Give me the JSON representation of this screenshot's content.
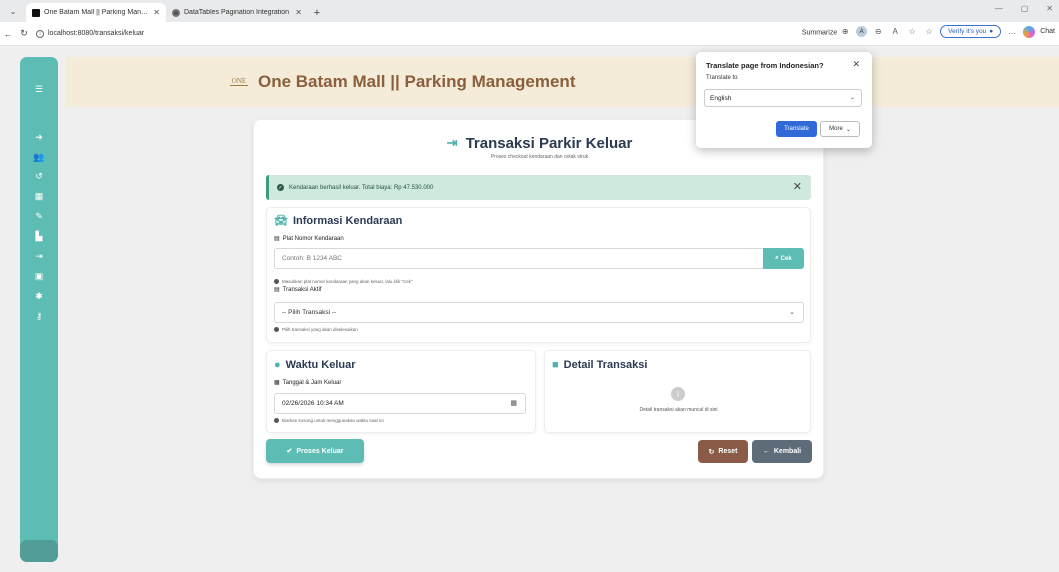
{
  "browser": {
    "tabs": [
      {
        "title": "One Batam Mall || Parking Manage",
        "active": true
      },
      {
        "title": "DataTables Pagination Integration",
        "active": false
      }
    ],
    "url": "localhost:8080/transaksi/keluar",
    "summarize_label": "Summarize",
    "verify_label": "Verify it's you",
    "chat_label": "Chat",
    "new_tab_symbol": "+"
  },
  "header": {
    "logo_text": "ONE",
    "title": "One Batam Mall || Parking Management"
  },
  "sidebar": {
    "menu_icon": "menu-icon",
    "items": [
      "login-icon",
      "users-icon",
      "history-icon",
      "table-icon",
      "edit-icon",
      "report-icon",
      "exit-icon",
      "card-icon",
      "gear-icon",
      "key-icon"
    ]
  },
  "page": {
    "title": "Transaksi Parkir Keluar",
    "subtitle": "Proses checkout kendaraan dan cetak struk",
    "alert": "Kendaraan berhasil keluar. Total biaya: Rp 47.530.000"
  },
  "vehicle_info": {
    "title": "Informasi Kendaraan",
    "plate_label": "Plat Nomor Kendaraan",
    "plate_placeholder": "Contoh: B 1234 ABC",
    "check_button": "Cek",
    "plate_help": "Masukkan plat nomor kendaraan yang akan keluar, lalu klik \"Cek\"",
    "active_tx_label": "Transaksi Aktif",
    "active_tx_value": "-- Pilih Transaksi --",
    "active_tx_help": "Pilih transaksi yang akan diselesaikan"
  },
  "exit_time": {
    "title": "Waktu Keluar",
    "datetime_label": "Tanggal & Jam Keluar",
    "datetime_value": "02/26/2026 10:34 AM",
    "help": "Biarkan kosong untuk menggunakan waktu saat ini"
  },
  "detail": {
    "title": "Detail Transaksi",
    "empty_text": "Detail transaksi akan muncul di sini"
  },
  "actions": {
    "process": "Proses Keluar",
    "reset": "Reset",
    "back": "Kembali"
  },
  "translate_popup": {
    "title": "Translate page from Indonesian?",
    "subtitle": "Translate to",
    "language": "English",
    "translate_button": "Translate",
    "more_button": "More"
  },
  "colors": {
    "teal": "#5dbdb5",
    "brown": "#8b5e3c",
    "alert_bg": "#cfe9df",
    "translate_blue": "#2f6ad8"
  }
}
